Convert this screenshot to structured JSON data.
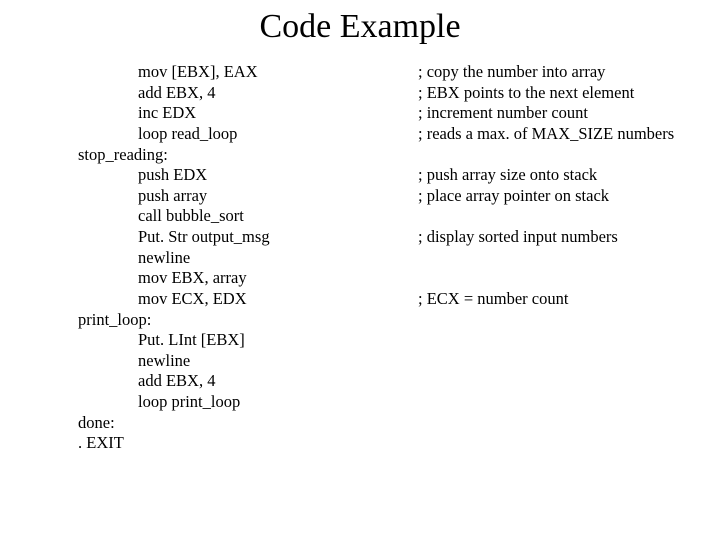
{
  "title": "Code Example",
  "lines": [
    {
      "indent": true,
      "instr": "mov [EBX], EAX",
      "comment": "; copy the number into array"
    },
    {
      "indent": true,
      "instr": "add EBX, 4",
      "comment": "; EBX points to the next element"
    },
    {
      "indent": true,
      "instr": "inc EDX",
      "comment": "; increment number count"
    },
    {
      "indent": true,
      "instr": "loop read_loop",
      "comment": "; reads a max. of MAX_SIZE numbers"
    },
    {
      "indent": false,
      "instr": "stop_reading:",
      "comment": ""
    },
    {
      "indent": true,
      "instr": "push EDX",
      "comment": "; push array size onto stack"
    },
    {
      "indent": true,
      "instr": "push array",
      "comment": "; place array pointer on stack"
    },
    {
      "indent": true,
      "instr": "call bubble_sort",
      "comment": ""
    },
    {
      "indent": true,
      "instr": "Put. Str output_msg",
      "comment": "; display sorted input numbers"
    },
    {
      "indent": true,
      "instr": "newline",
      "comment": ""
    },
    {
      "indent": true,
      "instr": "mov EBX, array",
      "comment": ""
    },
    {
      "indent": true,
      "instr": "mov ECX, EDX",
      "comment": "; ECX = number count"
    },
    {
      "indent": false,
      "instr": "print_loop:",
      "comment": ""
    },
    {
      "indent": true,
      "instr": "Put. LInt [EBX]",
      "comment": ""
    },
    {
      "indent": true,
      "instr": "newline",
      "comment": ""
    },
    {
      "indent": true,
      "instr": "add EBX, 4",
      "comment": ""
    },
    {
      "indent": true,
      "instr": "loop print_loop",
      "comment": ""
    },
    {
      "indent": false,
      "instr": "done:",
      "comment": ""
    },
    {
      "indent": false,
      "instr": ". EXIT",
      "comment": ""
    }
  ]
}
